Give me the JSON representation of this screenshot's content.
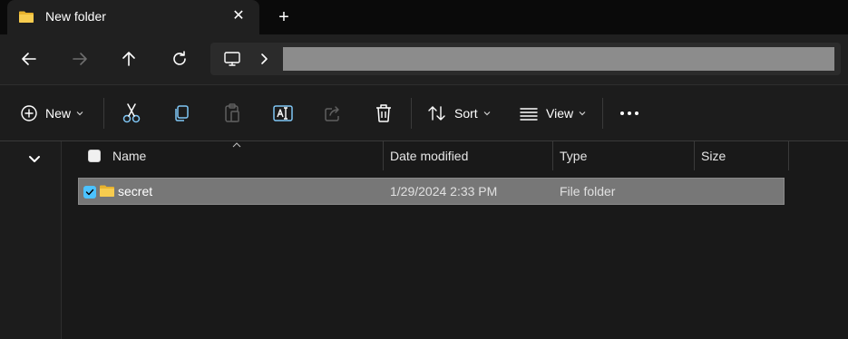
{
  "window": {
    "tab_title": "New folder",
    "tab_close_symbol": "✕",
    "new_tab_symbol": "+"
  },
  "nav": {
    "back_icon": "arrow-left-icon",
    "forward_icon": "arrow-right-icon",
    "up_icon": "arrow-up-icon",
    "refresh_icon": "refresh-icon",
    "address_root_icon": "this-pc-icon"
  },
  "toolbar": {
    "new_label": "New",
    "sort_label": "Sort",
    "view_label": "View",
    "icons": [
      "cut-icon",
      "copy-icon",
      "paste-icon",
      "rename-icon",
      "share-icon",
      "delete-icon"
    ]
  },
  "columns": {
    "name": "Name",
    "date": "Date modified",
    "type": "Type",
    "size": "Size"
  },
  "files": [
    {
      "name": "secret",
      "date_modified": "1/29/2024 2:33 PM",
      "type": "File folder",
      "size": "",
      "selected": true
    }
  ],
  "colors": {
    "accent": "#4cc2ff",
    "folder": "#f4c542",
    "background": "#191919",
    "selection": "#777777"
  }
}
